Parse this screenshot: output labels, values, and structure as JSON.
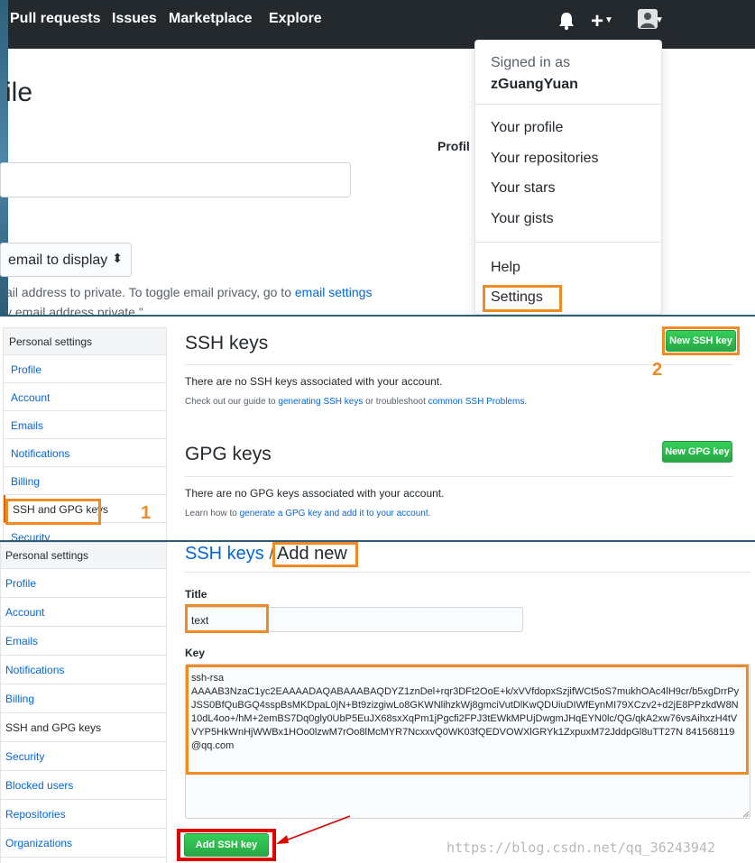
{
  "topnav": {
    "links": [
      "Pull requests",
      "Issues",
      "Marketplace",
      "Explore"
    ],
    "plus": "+"
  },
  "profile_page": {
    "title_fragment": "ile",
    "profile_label": "Profil",
    "email_select": "email to display",
    "help_text_prefix": "ail address to private. To toggle email privacy, go to ",
    "help_link": "email settings",
    "help_text2": "y email address private.\""
  },
  "dropdown": {
    "signed_in_label": "Signed in as",
    "username": "zGuangYuan",
    "items": [
      "Your profile",
      "Your repositories",
      "Your stars",
      "Your gists"
    ],
    "help": "Help",
    "settings": "Settings"
  },
  "ssh_settings": {
    "sidebar_header": "Personal settings",
    "sidebar_items": [
      "Profile",
      "Account",
      "Emails",
      "Notifications",
      "Billing",
      "SSH and GPG keys",
      "Security"
    ],
    "ssh_title": "SSH keys",
    "new_ssh_button": "New SSH key",
    "no_ssh": "There are no SSH keys associated with your account.",
    "guide_prefix": "Check out our guide to ",
    "guide_link1": "generating SSH keys",
    "guide_middle": " or troubleshoot ",
    "guide_link2": "common SSH Problems",
    "guide_suffix": ".",
    "gpg_title": "GPG keys",
    "new_gpg_button": "New GPG key",
    "no_gpg": "There are no GPG keys associated with your account.",
    "gpg_learn_prefix": "Learn how to ",
    "gpg_learn_link": "generate a GPG key and add it to your account",
    "gpg_learn_suffix": ".",
    "step1": "1",
    "step2": "2"
  },
  "add_ssh": {
    "sidebar_header": "Personal settings",
    "sidebar_items": [
      "Profile",
      "Account",
      "Emails",
      "Notifications",
      "Billing",
      "SSH and GPG keys",
      "Security",
      "Blocked users",
      "Repositories",
      "Organizations"
    ],
    "breadcrumb_link": "SSH keys",
    "breadcrumb_sep": "/",
    "breadcrumb_current": "Add new",
    "title_label": "Title",
    "title_value": "text",
    "key_label": "Key",
    "key_value": "ssh-rsa\nAAAAB3NzaC1yc2EAAAADAQABAAABAQDYZ1znDel+rqr3DFt2OoE+k/xVVfdopxSzjifWCt5oS7mukhOAc4lH9cr/b5xgDrrPyJSS0BfQuBGQ4sspBsMKDpaL0jN+Bt9zizgiwLo8GKWNlihzkWj8gmciVutDlKwQDUiuDIWfEynMI79XCzv2+d2jE8PPzkdW8N10dL4oo+/hM+2emBS7Dq0gly0UbP5EuJX68sxXqPm1jPgcfi2FPJ3tEWkMPUjDwgmJHqEYN0lc/QG/qkA2xw76vsAihxzH4tVVYP5HkWnHjWWBx1HOo0lzwM7rOo8lMcMYR7NcxxvQ0WK03fQEDVOWXlGRYk1ZxpuxM72JddpGl8uTT27N 841568119@qq.com",
    "add_button": "Add SSH key",
    "watermark": "https://blog.csdn.net/qq_36243942"
  },
  "colors": {
    "nav_bg": "#24292e",
    "highlight": "#f08a24",
    "green": "#28a745",
    "link": "#0366d6",
    "red": "#e00000"
  }
}
